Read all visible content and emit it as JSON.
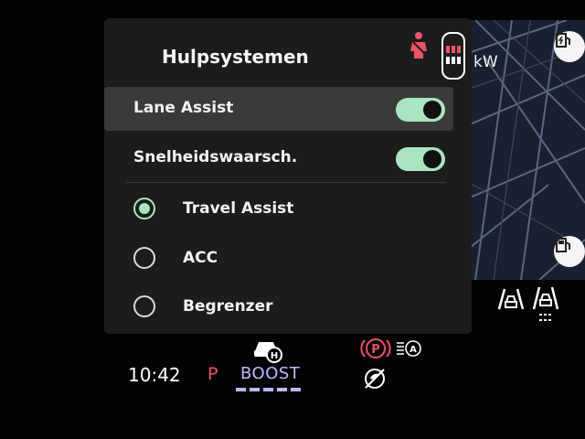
{
  "panel": {
    "title": "Hulpsystemen",
    "toggles": [
      {
        "label": "Lane Assist",
        "state": "on",
        "selected": true
      },
      {
        "label": "Snelheidswaarsch.",
        "state": "on",
        "selected": false
      }
    ],
    "radios": [
      {
        "label": "Travel Assist",
        "checked": true
      },
      {
        "label": "ACC",
        "checked": false
      },
      {
        "label": "Begrenzer",
        "checked": false
      }
    ]
  },
  "background": {
    "power_unit": "kW"
  },
  "status": {
    "time": "10:42",
    "gear": "P",
    "mode": "BOOST"
  },
  "colors": {
    "accent_green": "#a9e5c0",
    "warning_red": "#f0506a",
    "boost_violet": "#b8b9ff",
    "panel_bg": "#1c1c1c"
  },
  "icons": [
    "seatbelt-warning-icon",
    "car-overview-icon",
    "ev-charging-icon",
    "fuel-pump-icon",
    "lane-assist-indicator-icon",
    "adaptive-cruise-indicator-icon",
    "hybrid-car-icon",
    "parking-brake-icon",
    "auto-headlight-icon",
    "eco-off-icon"
  ]
}
